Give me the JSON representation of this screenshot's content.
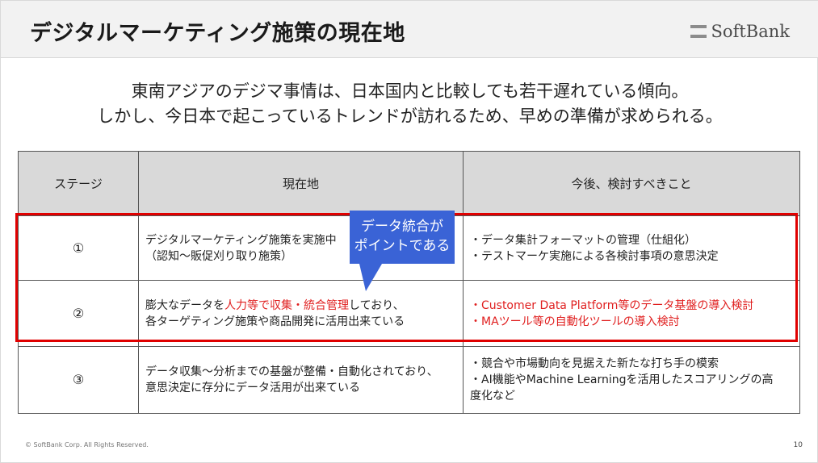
{
  "header": {
    "title": "デジタルマーケティング施策の現在地",
    "logo_text": "SoftBank"
  },
  "lead": {
    "line1": "東南アジアのデジマ事情は、日本国内と比較しても若干遅れている傾向。",
    "line2": "しかし、今日本で起こっているトレンドが訪れるため、早めの準備が求められる。"
  },
  "table": {
    "headers": [
      "ステージ",
      "現在地",
      "今後、検討すべきこと"
    ],
    "rows": [
      {
        "stage": "①",
        "current": [
          "デジタルマーケティング施策を実施中",
          "（認知～販促刈り取り施策）"
        ],
        "next": [
          "・データ集計フォーマットの管理（仕組化）",
          "・テストマーケ実施による各検討事項の意思決定"
        ]
      },
      {
        "stage": "②",
        "current_pre": "膨大なデータを",
        "current_em": "人力等で収集・統合管理",
        "current_post": "しており、",
        "current_line2": "各ターゲティング施策や商品開発に活用出来ている",
        "next": [
          "・Customer Data Platform等のデータ基盤の導入検討",
          "・MAツール等の自動化ツールの導入検討"
        ]
      },
      {
        "stage": "③",
        "current": [
          "データ収集～分析までの基盤が整備・自動化されており、",
          "意思決定に存分にデータ活用が出来ている"
        ],
        "next": [
          "・競合や市場動向を見据えた新たな打ち手の模索",
          "・AI機能やMachine Learningを活用したスコアリングの高",
          "度化など"
        ]
      }
    ]
  },
  "callout": {
    "line1": "データ統合が",
    "line2": "ポイントである"
  },
  "footer": {
    "copyright": "© SoftBank Corp. All Rights Reserved.",
    "page": "10"
  },
  "colors": {
    "highlight": "#e00000",
    "callout": "#3a63d6",
    "header_bg": "#f2f2f2",
    "table_header_bg": "#d9d9d9"
  }
}
